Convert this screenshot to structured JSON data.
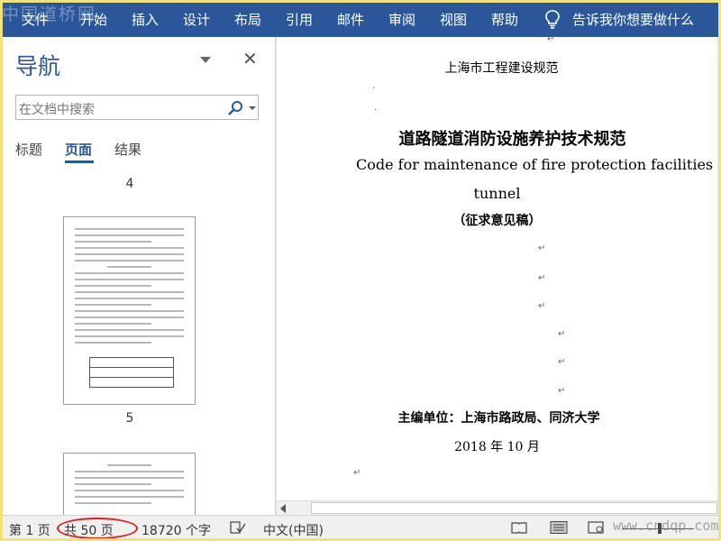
{
  "watermark_top": "中国道桥网",
  "watermark_bottom": "www.cndqp.com",
  "ribbon": {
    "tabs": [
      "文件",
      "开始",
      "插入",
      "设计",
      "布局",
      "引用",
      "邮件",
      "审阅",
      "视图",
      "帮助"
    ],
    "tell_me": "告诉我你想要做什么",
    "bulb_icon": "lightbulb-icon",
    "color": "#2b579a"
  },
  "nav": {
    "title": "导航",
    "search_placeholder": "在文档中搜索",
    "tabs": [
      "标题",
      "页面",
      "结果"
    ],
    "active_tab": "页面",
    "page_labels": [
      "4",
      "5"
    ]
  },
  "document": {
    "header": "上海市工程建设规范",
    "title_cn": "道路隧道消防设施养护技术规范",
    "title_en_1": "Code for maintenance of fire protection facilities of road",
    "title_en_2": "tunnel",
    "draft_label": "（征求意见稿）",
    "editors": "主编单位：上海市路政局、同济大学",
    "date": "2018 年 10 月"
  },
  "status": {
    "page": "第 1 页",
    "total_pages": "共 50 页",
    "word_count": "18720 个字",
    "language": "中文(中国)"
  }
}
